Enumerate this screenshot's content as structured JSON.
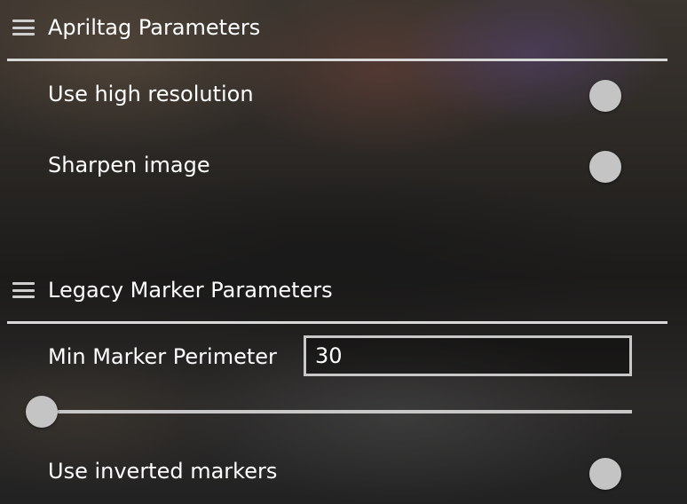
{
  "sections": [
    {
      "title": "Apriltag Parameters",
      "settings": [
        {
          "label": "Use high resolution",
          "type": "toggle",
          "value": false
        },
        {
          "label": "Sharpen image",
          "type": "toggle",
          "value": false
        }
      ]
    },
    {
      "title": "Legacy Marker Parameters",
      "settings": [
        {
          "label": "Min Marker Perimeter",
          "type": "number",
          "value": "30",
          "slider_fraction": 0
        },
        {
          "label": "Use inverted markers",
          "type": "toggle",
          "value": false
        }
      ]
    }
  ],
  "icons": {
    "drag_handle": "hamburger-icon"
  },
  "colors": {
    "text": "#ffffff",
    "divider": "#d8d8d8",
    "control": "#c4c4c4"
  }
}
